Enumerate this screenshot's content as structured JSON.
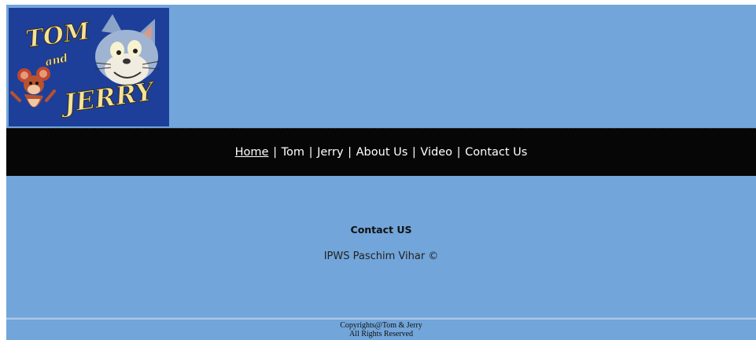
{
  "header": {
    "logo": {
      "title_top": "TOM",
      "title_and": "and",
      "title_bottom": "JERRY",
      "icon": "tom-and-jerry-logo-icon"
    }
  },
  "nav": {
    "items": [
      {
        "label": "Home",
        "active": true
      },
      {
        "label": "Tom",
        "active": false
      },
      {
        "label": "Jerry",
        "active": false
      },
      {
        "label": "About Us",
        "active": false
      },
      {
        "label": "Video",
        "active": false
      },
      {
        "label": "Contact Us",
        "active": false
      }
    ],
    "separator": "|"
  },
  "main": {
    "heading": "Contact US",
    "address": "IPWS Paschim Vihar ©"
  },
  "footer": {
    "line1": "Copyrights@Tom & Jerry",
    "line2": "All Rights Reserved"
  },
  "colors": {
    "page_background": "#72a5d9",
    "nav_background": "#060606",
    "nav_text": "#ffffff",
    "logo_background": "#1d3f9a"
  }
}
